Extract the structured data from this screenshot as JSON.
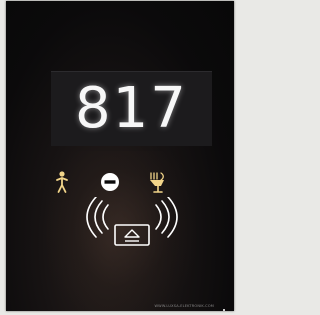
{
  "device": {
    "room_number": "817",
    "brand_text": "WWW.LUXSA-ELEKTRONIK.COM"
  },
  "status_icons": [
    {
      "name": "presence-icon",
      "meaning": "guest present",
      "color": "#f2d58a"
    },
    {
      "name": "do-not-disturb-icon",
      "meaning": "do not disturb",
      "color": "#ffffff"
    },
    {
      "name": "service-icon",
      "meaning": "housekeeping",
      "color": "#f2d58a"
    }
  ],
  "card_reader": {
    "icon": "nfc-card-reader-icon",
    "color": "#ffffff"
  },
  "colors": {
    "panel": "#0b0a0b",
    "number_window": "#1c1b1d",
    "number_text": "#f7f7f7",
    "accent_icon": "#f2d58a"
  }
}
